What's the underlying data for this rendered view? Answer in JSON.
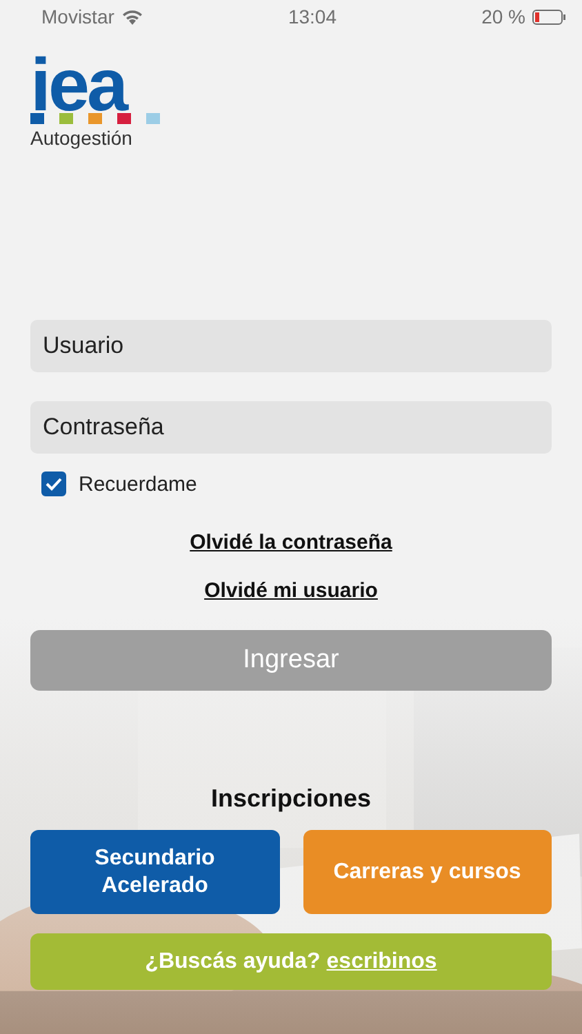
{
  "status_bar": {
    "carrier": "Movistar",
    "time": "13:04",
    "battery": "20 %"
  },
  "logo": {
    "mark": "iea",
    "subtitle": "Autogestión"
  },
  "fields": [
    {
      "placeholder": "Usuario"
    },
    {
      "placeholder": "Contraseña"
    }
  ],
  "remember": {
    "label": "Recuerdame",
    "checked": true
  },
  "links": [
    "Olvidé la contraseña",
    "Olvidé mi usuario"
  ],
  "login_button": {
    "label": "Ingresar",
    "disabled": true
  },
  "inscriptions": {
    "title": "Inscripciones",
    "buttons": [
      {
        "label": "Secundario Acelerado",
        "color": "#0f5ca8"
      },
      {
        "label": "Carreras y cursos",
        "color": "#e98d25"
      }
    ]
  },
  "help": {
    "text": "¿Buscás ayuda?",
    "link": "escribinos"
  }
}
